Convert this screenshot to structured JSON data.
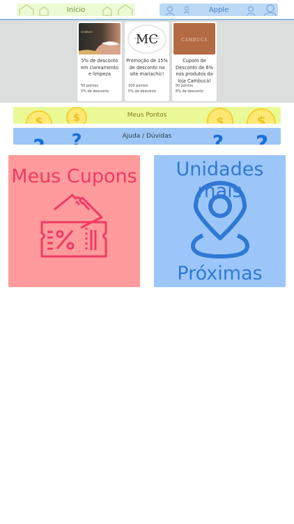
{
  "topbar": {
    "home_label": "Início",
    "user_label": "Apple",
    "home_icon": "house-icon",
    "user_icon": "user-icon"
  },
  "coupons": [
    {
      "brand": "SORRISO",
      "title": "5% de desconto em clareamento e limpeza",
      "points": "50 pontos",
      "discount": "5% de desconto"
    },
    {
      "brand": "MC",
      "title": "Promoção de 15% de desconto no site mariachic!",
      "points": "100 pontos",
      "discount": "5% de desconto"
    },
    {
      "brand": "CAMBUCÁ",
      "title": "Cupom de Desconto de 6% nos produtos da loja Cambucá!",
      "points": "50 pontos",
      "discount": "6% de desconto"
    }
  ],
  "banners": {
    "points_label": "Meus Pontos",
    "help_label": "Ajuda / Dúvidas"
  },
  "tiles": {
    "coupons_title": "Meus Cupons",
    "units_title_1": "Unidades mais",
    "units_title_2": "Próximas"
  },
  "colors": {
    "home_pill": "#ecfbd4",
    "user_pill": "#bcd8f7",
    "points_banner": "#ebf896",
    "help_banner": "#9dc6f7",
    "coupons_tile": "#ff9b9d",
    "coupons_accent": "#f03a63",
    "units_tile": "#9cc6f9",
    "units_accent": "#2f79d5"
  }
}
